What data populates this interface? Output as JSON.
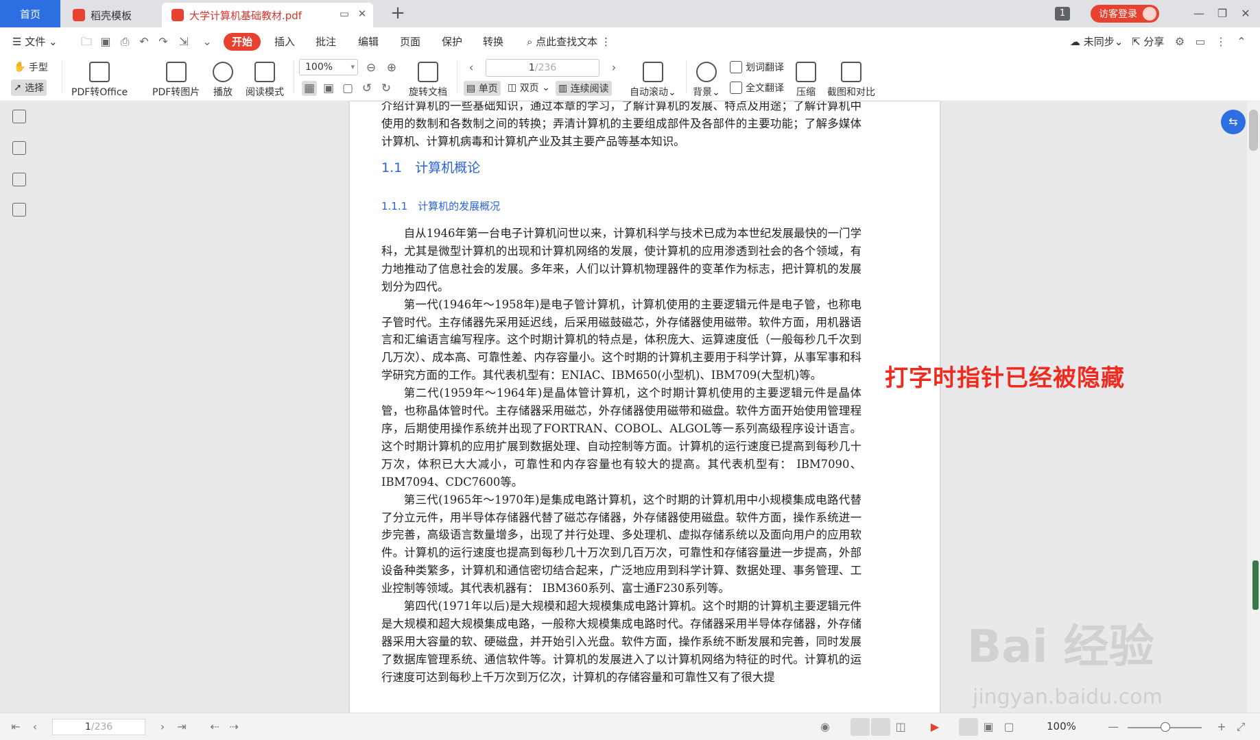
{
  "tabs": {
    "home": "首页",
    "template": "稻壳模板",
    "document": "大学计算机基础教材.pdf"
  },
  "titlebar": {
    "window_count": "1",
    "login_label": "访客登录"
  },
  "menu": {
    "file": "文件",
    "start": "开始",
    "insert": "插入",
    "annotate": "批注",
    "edit": "编辑",
    "page": "页面",
    "protect": "保护",
    "convert": "转换",
    "search": "点此查找文本",
    "sync": "未同步",
    "share": "分享"
  },
  "ribbon": {
    "hand": "手型",
    "select": "选择",
    "pdf_to_office": "PDF转Office",
    "pdf_to_image": "PDF转图片",
    "play": "播放",
    "read_mode": "阅读模式",
    "zoom": "100%",
    "rotate": "旋转文档",
    "page_current": "1",
    "page_total": "/236",
    "single": "单页",
    "double": "双页",
    "continuous": "连续阅读",
    "auto_scroll": "自动滚动",
    "background": "背景",
    "word_translate": "划词翻译",
    "full_translate": "全文翻译",
    "compress": "压缩",
    "screenshot_compare": "截图和对比"
  },
  "document": {
    "intro": "介绍计算机的一些基础知识，通过本章的学习，了解计算机的发展、特点及用途；了解计算机中使用的数制和各数制之间的转换；弄清计算机的主要组成部件及各部件的主要功能；了解多媒体计算机、计算机病毒和计算机产业及其主要产品等基本知识。",
    "heading1": "1.1　计算机概论",
    "heading2": "1.1.1　计算机的发展概况",
    "paragraphs": [
      "自从1946年第一台电子计算机问世以来，计算机科学与技术已成为本世纪发展最快的一门学科，尤其是微型计算机的出现和计算机网络的发展，使计算机的应用渗透到社会的各个领域，有力地推动了信息社会的发展。多年来，人们以计算机物理器件的变革作为标志，把计算机的发展划分为四代。",
      "第一代(1946年～1958年)是电子管计算机，计算机使用的主要逻辑元件是电子管，也称电子管时代。主存储器先采用延迟线，后采用磁鼓磁芯，外存储器使用磁带。软件方面，用机器语言和汇编语言编写程序。这个时期计算机的特点是，体积庞大、运算速度低（一般每秒几千次到几万次）、成本高、可靠性差、内存容量小。这个时期的计算机主要用于科学计算，从事军事和科学研究方面的工作。其代表机型有：ENIAC、IBM650(小型机)、IBM709(大型机)等。",
      "第二代(1959年～1964年)是晶体管计算机，这个时期计算机使用的主要逻辑元件是晶体管，也称晶体管时代。主存储器采用磁芯，外存储器使用磁带和磁盘。软件方面开始使用管理程序，后期使用操作系统并出现了FORTRAN、COBOL、ALGOL等一系列高级程序设计语言。这个时期计算机的应用扩展到数据处理、自动控制等方面。计算机的运行速度已提高到每秒几十万次，体积已大大减小，可靠性和内存容量也有较大的提高。其代表机型有： IBM7090、IBM7094、CDC7600等。",
      "第三代(1965年～1970年)是集成电路计算机，这个时期的计算机用中小规模集成电路代替了分立元件，用半导体存储器代替了磁芯存储器，外存储器使用磁盘。软件方面，操作系统进一步完善，高级语言数量增多，出现了并行处理、多处理机、虚拟存储系统以及面向用户的应用软件。计算机的运行速度也提高到每秒几十万次到几百万次，可靠性和存储容量进一步提高，外部设备种类繁多，计算机和通信密切结合起来，广泛地应用到科学计算、数据处理、事务管理、工业控制等领域。其代表机器有： IBM360系列、富士通F230系列等。",
      "第四代(1971年以后)是大规模和超大规模集成电路计算机。这个时期的计算机主要逻辑元件是大规模和超大规模集成电路，一般称大规模集成电路时代。存储器采用半导体存储器，外存储器采用大容量的软、硬磁盘，并开始引入光盘。软件方面，操作系统不断发展和完善，同时发展了数据库管理系统、通信软件等。计算机的发展进入了以计算机网络为特征的时代。计算机的运行速度可达到每秒上千万次到万亿次，计算机的存储容量和可靠性又有了很大提"
    ]
  },
  "annotation": "打字时指针已经被隐藏",
  "watermark": {
    "brand": "Bai 经验",
    "url": "jingyan.baidu.com"
  },
  "statusbar": {
    "page_current": "1",
    "page_total": "/236",
    "zoom": "100%"
  }
}
